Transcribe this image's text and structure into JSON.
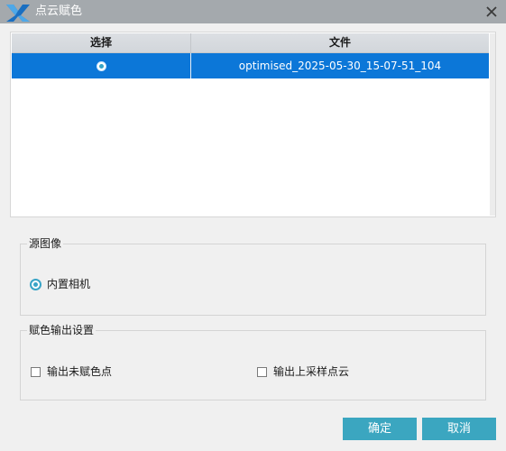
{
  "window": {
    "title": "点云赋色",
    "icon": "app-logo-icon",
    "close_icon": "close-icon"
  },
  "table": {
    "columns": [
      "选择",
      "文件"
    ],
    "rows": [
      {
        "selected": true,
        "file": "optimised_2025-05-30_15-07-51_104"
      }
    ]
  },
  "source_group": {
    "title": "源图像",
    "option_label": "内置相机",
    "option_selected": true
  },
  "output_group": {
    "title": "赋色输出设置",
    "option1_label": "输出未赋色点",
    "option1_checked": false,
    "option2_label": "输出上采样点云",
    "option2_checked": false
  },
  "buttons": {
    "ok": "确定",
    "cancel": "取消"
  },
  "colors": {
    "titlebar_bg": "#a4a9ad",
    "selection_blue": "#0c77d8",
    "accent_teal": "#3ba6c0",
    "window_bg": "#f0f0f0"
  }
}
